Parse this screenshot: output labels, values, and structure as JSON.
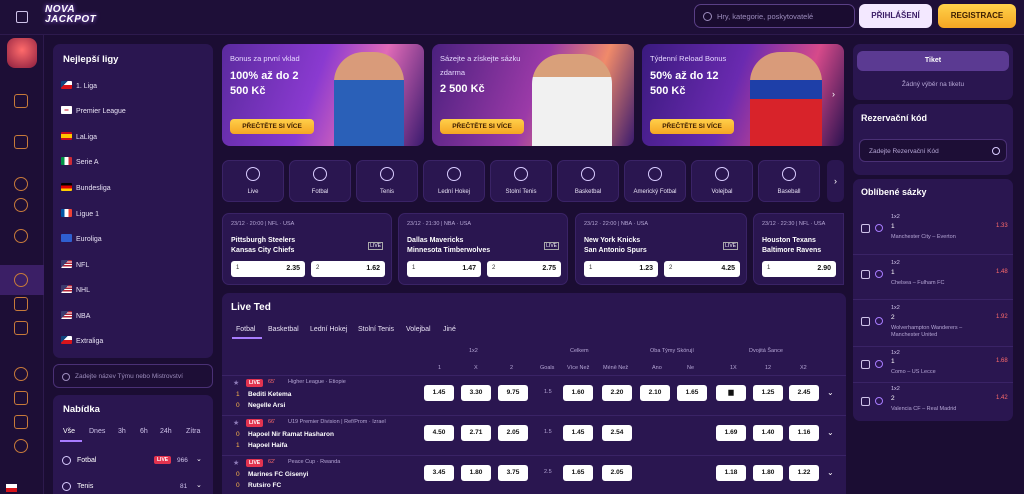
{
  "header": {
    "logo_top": "NOVA",
    "logo_bottom": "JACKPOT",
    "search_placeholder": "Hry, kategorie, poskytovatelé",
    "login_label": "PŘIHLÁŠENÍ",
    "register_label": "REGISTRACE"
  },
  "leagues": {
    "title": "Nejlepší ligy",
    "items": [
      {
        "label": "1. Liga",
        "flag": "cz"
      },
      {
        "label": "Premier League",
        "flag": "en"
      },
      {
        "label": "LaLiga",
        "flag": "es"
      },
      {
        "label": "Serie A",
        "flag": "it"
      },
      {
        "label": "Bundesliga",
        "flag": "de"
      },
      {
        "label": "Ligue 1",
        "flag": "fr"
      },
      {
        "label": "Euroliga",
        "flag": "eu"
      },
      {
        "label": "NFL",
        "flag": "us"
      },
      {
        "label": "NHL",
        "flag": "us"
      },
      {
        "label": "NBA",
        "flag": "us"
      },
      {
        "label": "Extraliga",
        "flag": "cz"
      }
    ],
    "team_search_placeholder": "Zadejte název Týmu nebo Mistrovství"
  },
  "offer": {
    "title": "Nabídka",
    "tabs": [
      "Vše",
      "Dnes",
      "3h",
      "6h",
      "24h",
      "Zítra"
    ],
    "sports": [
      {
        "label": "Fotbal",
        "live": "LIVE",
        "count": "966"
      },
      {
        "label": "Tenis",
        "live": "",
        "count": "81"
      }
    ]
  },
  "promos": [
    {
      "line1": "Bonus za první vklad",
      "line2": "100% až do 2",
      "line3": "500 Kč",
      "cta": "PŘEČTĚTE SI VÍCE"
    },
    {
      "line1": "Sázejte a získejte sázku",
      "line2": "zdarma",
      "line3": "2 500 Kč",
      "cta": "PŘEČTĚTE SI VÍCE"
    },
    {
      "line1": "Týdenní Reload Bonus",
      "line2": "50% až do 12",
      "line3": "500 Kč",
      "cta": "PŘEČTĚTE SI VÍCE"
    }
  ],
  "sports_bar": [
    "Live",
    "Fotbal",
    "Tenis",
    "Lední Hokej",
    "Stolní Tenis",
    "Basketbal",
    "Americký Fotbal",
    "Volejbal",
    "Baseball"
  ],
  "matches": [
    {
      "meta": "23/12 · 20:00 | NFL · USA",
      "home": "Pittsburgh Steelers",
      "away": "Kansas City Chiefs",
      "o1": "2.35",
      "o2": "1.62"
    },
    {
      "meta": "23/12 · 21:30 | NBA · USA",
      "home": "Dallas Mavericks",
      "away": "Minnesota Timberwolves",
      "o1": "1.47",
      "o2": "2.75"
    },
    {
      "meta": "23/12 · 22:00 | NBA · USA",
      "home": "New York Knicks",
      "away": "San Antonio Spurs",
      "o1": "1.23",
      "o2": "4.25"
    },
    {
      "meta": "23/12 · 22:30 | NFL · USA",
      "home": "Houston Texans",
      "away": "Baltimore Ravens",
      "o1": "2.90",
      "o2": ""
    }
  ],
  "live": {
    "title": "Live Ted",
    "tabs": [
      "Fotbal",
      "Basketbal",
      "Lední Hokej",
      "Stolní Tenis",
      "Volejbal",
      "Jiné"
    ],
    "group_headers": [
      "1x2",
      "Celkem",
      "Oba Týmy Skórují",
      "Dvojitá Šance"
    ],
    "col_headers": [
      "1",
      "X",
      "2",
      "Goals",
      "Více Než",
      "Méně Než",
      "Ano",
      "Ne",
      "1X",
      "12",
      "X2"
    ],
    "rows": [
      {
        "badge": "LIVE",
        "minute": "65'",
        "league": "Higher League · Etiopie",
        "s1": "1",
        "t1": "Bediti Ketema",
        "s2": "0",
        "t2": "Negelle Arsi",
        "odds": [
          "1.45",
          "3.30",
          "9.75",
          "1.5",
          "1.60",
          "2.20",
          "2.10",
          "1.65",
          "",
          "1.25",
          "2.45"
        ]
      },
      {
        "badge": "LIVE",
        "minute": "66'",
        "league": "U19 Premier Division | Ref/Prom · Izrael",
        "s1": "0",
        "t1": "Hapoel Nir Ramat Hasharon",
        "s2": "1",
        "t2": "Hapoel Haifa",
        "odds": [
          "4.50",
          "2.71",
          "2.05",
          "1.5",
          "1.45",
          "2.54",
          "",
          "",
          "1.69",
          "1.40",
          "1.16"
        ]
      },
      {
        "badge": "LIVE",
        "minute": "62'",
        "league": "Peace Cup · Rwanda",
        "s1": "0",
        "t1": "Marines FC Gisenyi",
        "s2": "0",
        "t2": "Rutsiro FC",
        "odds": [
          "3.45",
          "1.80",
          "3.75",
          "2.5",
          "1.65",
          "2.05",
          "",
          "",
          "1.18",
          "1.80",
          "1.22"
        ]
      }
    ]
  },
  "betslip": {
    "ticket_label": "Tiket",
    "empty_text": "Žádný výběr na tiketu"
  },
  "reservation": {
    "title": "Rezervační kód",
    "placeholder": "Zadejte Rezervační Kód"
  },
  "favorites": {
    "title": "Oblíbené sázky",
    "items": [
      {
        "market": "1x2",
        "pick": "1",
        "match": "Manchester City – Everton",
        "odd": "1.33"
      },
      {
        "market": "1x2",
        "pick": "1",
        "match": "Chelsea – Fulham FC",
        "odd": "1.48"
      },
      {
        "market": "1x2",
        "pick": "2",
        "match": "Wolverhampton Wanderers – Manchester United",
        "odd": "1.92"
      },
      {
        "market": "1x2",
        "pick": "1",
        "match": "Como – US Lecce",
        "odd": "1.68"
      },
      {
        "market": "1x2",
        "pick": "2",
        "match": "Valencia CF – Real Madrid",
        "odd": "1.42"
      }
    ]
  }
}
